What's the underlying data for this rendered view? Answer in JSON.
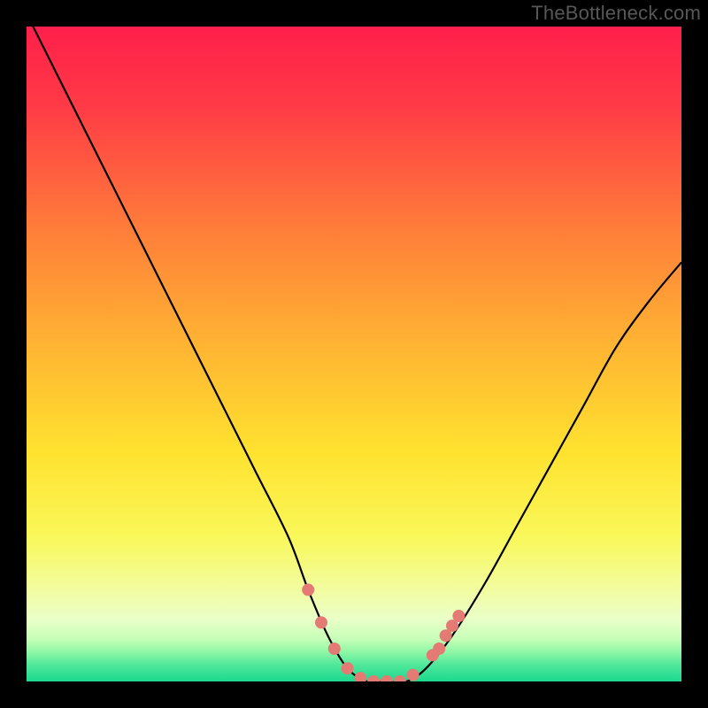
{
  "watermark": "TheBottleneck.com",
  "chart_data": {
    "type": "line",
    "title": "",
    "xlabel": "",
    "ylabel": "",
    "xlim": [
      0,
      100
    ],
    "ylim": [
      0,
      100
    ],
    "series": [
      {
        "name": "bottleneck-curve",
        "x": [
          0,
          5,
          10,
          15,
          20,
          25,
          30,
          35,
          40,
          43,
          46,
          49,
          52,
          55,
          58,
          61,
          65,
          70,
          75,
          80,
          85,
          90,
          95,
          100
        ],
        "y": [
          102,
          92,
          82,
          72,
          62,
          52,
          42,
          32,
          22,
          14,
          7,
          2,
          0,
          0,
          0,
          2,
          7,
          15,
          24,
          33,
          42,
          51,
          58,
          64
        ]
      }
    ],
    "markers": {
      "name": "highlight-points",
      "color": "#e47a74",
      "points": [
        {
          "x": 43,
          "y": 14,
          "r": 1.0
        },
        {
          "x": 45,
          "y": 9,
          "r": 1.0
        },
        {
          "x": 47,
          "y": 5,
          "r": 1.0
        },
        {
          "x": 49,
          "y": 2,
          "r": 1.0
        },
        {
          "x": 51,
          "y": 0.5,
          "r": 1.0
        },
        {
          "x": 53,
          "y": 0,
          "r": 1.0
        },
        {
          "x": 55,
          "y": 0,
          "r": 1.0
        },
        {
          "x": 57,
          "y": 0,
          "r": 1.0
        },
        {
          "x": 59,
          "y": 1,
          "r": 1.0
        },
        {
          "x": 62,
          "y": 4,
          "r": 1.0
        },
        {
          "x": 63,
          "y": 5,
          "r": 1.0
        },
        {
          "x": 64,
          "y": 7,
          "r": 1.0
        },
        {
          "x": 65,
          "y": 8.5,
          "r": 1.0
        },
        {
          "x": 66,
          "y": 10,
          "r": 1.0
        }
      ]
    },
    "gradient_stops": [
      {
        "offset": 0,
        "color": "#ff1f4b"
      },
      {
        "offset": 0.12,
        "color": "#ff3a46"
      },
      {
        "offset": 0.3,
        "color": "#ff7a3a"
      },
      {
        "offset": 0.48,
        "color": "#ffb233"
      },
      {
        "offset": 0.65,
        "color": "#ffe22f"
      },
      {
        "offset": 0.78,
        "color": "#f9f85a"
      },
      {
        "offset": 0.86,
        "color": "#f2fca0"
      },
      {
        "offset": 0.905,
        "color": "#eaffc8"
      },
      {
        "offset": 0.935,
        "color": "#c7ffb8"
      },
      {
        "offset": 0.955,
        "color": "#8ef7a6"
      },
      {
        "offset": 0.975,
        "color": "#4fe79a"
      },
      {
        "offset": 1.0,
        "color": "#19d98e"
      }
    ]
  }
}
